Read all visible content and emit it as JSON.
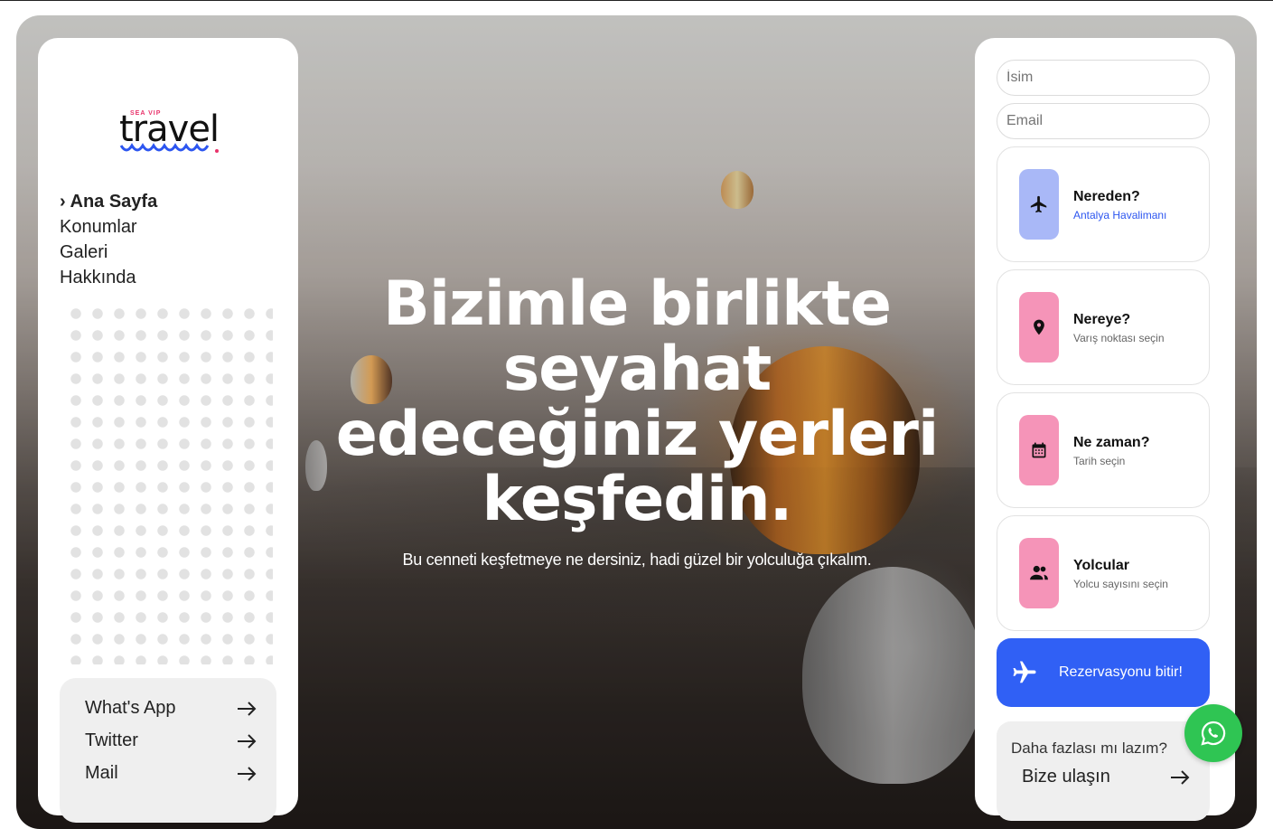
{
  "brand": {
    "logo_top": "SEA VIP",
    "logo_word": "travel"
  },
  "nav": {
    "items": [
      {
        "label": "Ana Sayfa",
        "prefix": "›"
      },
      {
        "label": "Konumlar"
      },
      {
        "label": "Galeri"
      },
      {
        "label": "Hakkında"
      }
    ]
  },
  "contacts": [
    {
      "label": "What's App"
    },
    {
      "label": "Twitter"
    },
    {
      "label": "Mail"
    }
  ],
  "hero": {
    "lines": [
      "Bizimle birlikte",
      "seyahat",
      "edeceğiniz yerleri",
      "keşfedin."
    ],
    "subtitle": "Bu cenneti keşfetmeye ne dersiniz, hadi güzel bir yolculuğa çıkalım."
  },
  "form": {
    "name_placeholder": "İsim",
    "email_placeholder": "Email",
    "options": [
      {
        "title": "Nereden?",
        "sub": "Antalya Havalimanı",
        "icon": "airplane-icon",
        "color": "#a9b8f7"
      },
      {
        "title": "Nereye?",
        "sub": "Varış noktası seçin",
        "icon": "location-pin-icon",
        "color": "#f594b8"
      },
      {
        "title": "Ne zaman?",
        "sub": "Tarih seçin",
        "icon": "calendar-icon",
        "color": "#f594b8"
      },
      {
        "title": "Yolcular",
        "sub": "Yolcu sayısını seçin",
        "icon": "people-icon",
        "color": "#f594b8"
      }
    ],
    "book_label": "Rezervasyonu bitir!",
    "book_color": "#3060f5"
  },
  "help": {
    "question": "Daha fazlası mı lazım?",
    "link": "Bize ulaşın"
  },
  "whatsapp_color": "#2fc553"
}
